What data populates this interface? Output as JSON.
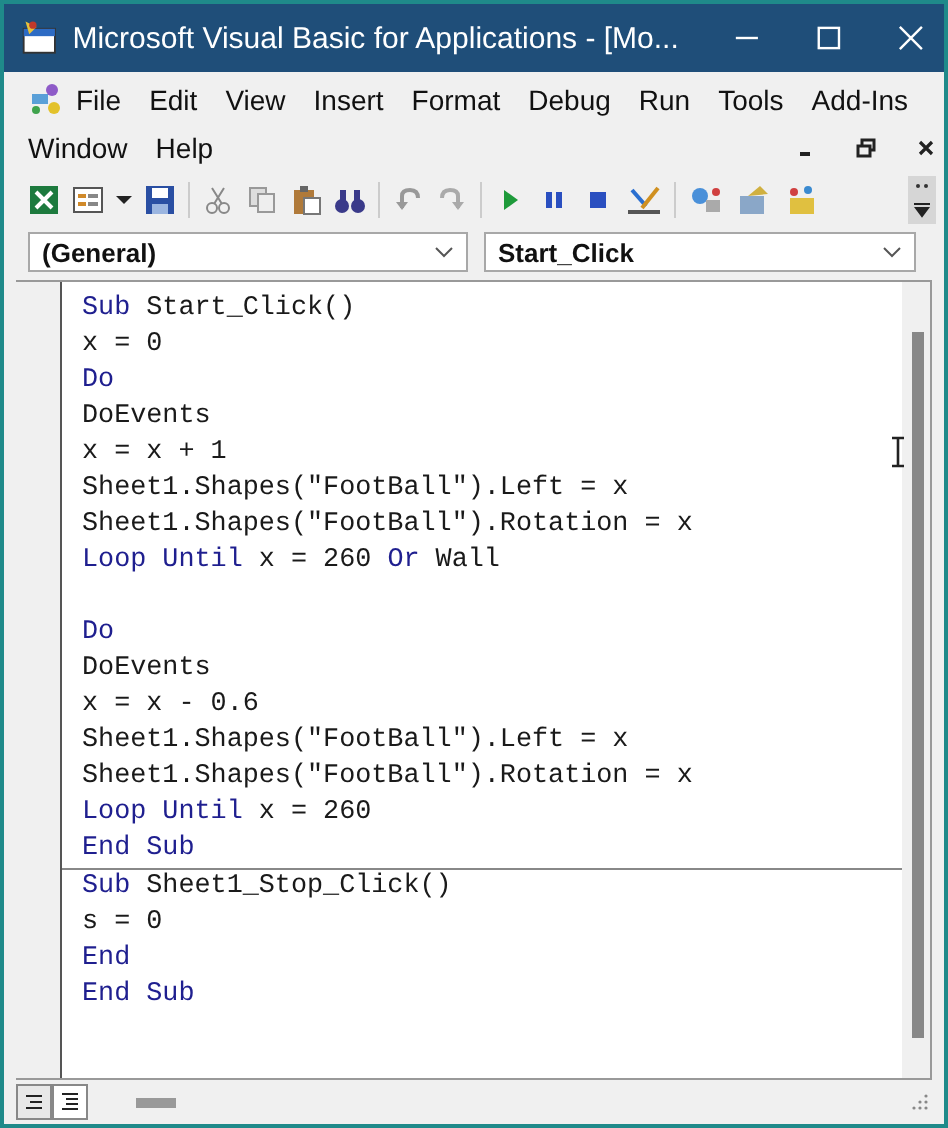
{
  "window": {
    "title": "Microsoft Visual Basic for Applications - [Mo..."
  },
  "menu": [
    "File",
    "Edit",
    "View",
    "Insert",
    "Format",
    "Debug",
    "Run",
    "Tools",
    "Add-Ins",
    "Window",
    "Help"
  ],
  "object_dropdown": {
    "value": "(General)"
  },
  "procedure_dropdown": {
    "value": "Start_Click"
  },
  "procedures": [
    {
      "blocks": [
        {
          "lines": [
            {
              "segments": [
                {
                  "kind": "keyword",
                  "text": "Sub"
                },
                {
                  "kind": "plain",
                  "text": " Start_Click()"
                }
              ]
            },
            {
              "segments": [
                {
                  "kind": "plain",
                  "text": "x = 0"
                }
              ]
            },
            {
              "segments": [
                {
                  "kind": "keyword",
                  "text": "Do"
                }
              ]
            },
            {
              "segments": [
                {
                  "kind": "plain",
                  "text": "DoEvents"
                }
              ]
            },
            {
              "segments": [
                {
                  "kind": "plain",
                  "text": "x = x + 1"
                }
              ]
            },
            {
              "segments": [
                {
                  "kind": "plain",
                  "text": "Sheet1.Shapes(\"FootBall\").Left = x"
                }
              ]
            },
            {
              "segments": [
                {
                  "kind": "plain",
                  "text": "Sheet1.Shapes(\"FootBall\").Rotation = x"
                }
              ]
            },
            {
              "segments": [
                {
                  "kind": "keyword",
                  "text": "Loop Until"
                },
                {
                  "kind": "plain",
                  "text": " x = 260 "
                },
                {
                  "kind": "keyword",
                  "text": "Or"
                },
                {
                  "kind": "plain",
                  "text": " Wall"
                }
              ]
            }
          ]
        },
        {
          "lines": [
            {
              "segments": [
                {
                  "kind": "keyword",
                  "text": "Do"
                }
              ]
            },
            {
              "segments": [
                {
                  "kind": "plain",
                  "text": "DoEvents"
                }
              ]
            },
            {
              "segments": [
                {
                  "kind": "plain",
                  "text": "x = x - 0.6"
                }
              ]
            },
            {
              "segments": [
                {
                  "kind": "plain",
                  "text": "Sheet1.Shapes(\"FootBall\").Left = x"
                }
              ]
            },
            {
              "segments": [
                {
                  "kind": "plain",
                  "text": "Sheet1.Shapes(\"FootBall\").Rotation = x"
                }
              ]
            },
            {
              "segments": [
                {
                  "kind": "keyword",
                  "text": "Loop Until"
                },
                {
                  "kind": "plain",
                  "text": " x = 260"
                }
              ]
            },
            {
              "segments": [
                {
                  "kind": "keyword",
                  "text": "End Sub"
                }
              ]
            }
          ]
        }
      ]
    },
    {
      "blocks": [
        {
          "lines": [
            {
              "segments": [
                {
                  "kind": "keyword",
                  "text": "Sub"
                },
                {
                  "kind": "plain",
                  "text": " Sheet1_Stop_Click()"
                }
              ]
            },
            {
              "segments": [
                {
                  "kind": "plain",
                  "text": "s = 0"
                }
              ]
            },
            {
              "segments": [
                {
                  "kind": "keyword",
                  "text": "End"
                }
              ]
            },
            {
              "segments": [
                {
                  "kind": "keyword",
                  "text": "End Sub"
                }
              ]
            }
          ]
        }
      ]
    }
  ]
}
